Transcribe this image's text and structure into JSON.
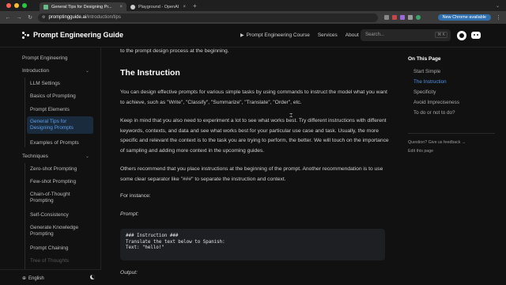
{
  "browser": {
    "tabs": [
      {
        "label": "General Tips for Designing Pr...",
        "active": true
      },
      {
        "label": "Playground - OpenAI API",
        "active": false
      }
    ],
    "new_tab": "+",
    "url_host": "promptingguide.ai",
    "url_path": "/introduction/tips",
    "chrome_badge": "New Chrome available",
    "colors": {
      "close": "#ff5f57",
      "minimize": "#febc2e",
      "zoom": "#28c840",
      "badge": "#2f6fb0"
    }
  },
  "header": {
    "brand": "Prompt Engineering Guide",
    "nav": [
      "Prompt Engineering Course",
      "Services",
      "About"
    ],
    "search_placeholder": "Search...",
    "search_shortcut": "⌘ K"
  },
  "sidebar": {
    "items": [
      {
        "label": "Prompt Engineering"
      },
      {
        "label": "Introduction"
      },
      {
        "label": "LLM Settings"
      },
      {
        "label": "Basics of Prompting"
      },
      {
        "label": "Prompt Elements"
      },
      {
        "label": "General Tips for Designing Prompts"
      },
      {
        "label": "Examples of Prompts"
      },
      {
        "label": "Techniques"
      },
      {
        "label": "Zero-shot Prompting"
      },
      {
        "label": "Few-shot Prompting"
      },
      {
        "label": "Chain-of-Thought Prompting"
      },
      {
        "label": "Self-Consistency"
      },
      {
        "label": "Generate Knowledge Prompting"
      },
      {
        "label": "Prompt Chaining"
      },
      {
        "label": "Tree of Thoughts"
      }
    ],
    "language": "English",
    "accent": "#5a9ee8"
  },
  "content": {
    "intro_tail": "to the prompt design process at the beginning.",
    "heading": "The Instruction",
    "p1": "You can design effective prompts for various simple tasks by using commands to instruct the model what you want to achieve, such as \"Write\", \"Classify\", \"Summarize\", \"Translate\", \"Order\", etc.",
    "p2": "Keep in mind that you also need to experiment a lot to see what works best. Try different instructions with different keywords, contexts, and data and see what works best for your particular use case and task. Usually, the more specific and relevant the context is to the task you are trying to perform, the better. We will touch on the importance of sampling and adding more context in the upcoming guides.",
    "p3": "Others recommend that you place instructions at the beginning of the prompt. Another recommendation is to use some clear separator like \"###\" to separate the instruction and context.",
    "p4": "For instance:",
    "prompt_label": "Prompt:",
    "code": "### Instruction ###\nTranslate the text below to Spanish:\nText: \"hello!\"",
    "output_label": "Output:"
  },
  "toc": {
    "title": "On This Page",
    "items": [
      "Start Simple",
      "The Instruction",
      "Specificity",
      "Avoid Impreciseness",
      "To do or not to do?"
    ],
    "feedback": "Question? Give us feedback →",
    "edit": "Edit this page",
    "accent": "#4f94e3"
  }
}
